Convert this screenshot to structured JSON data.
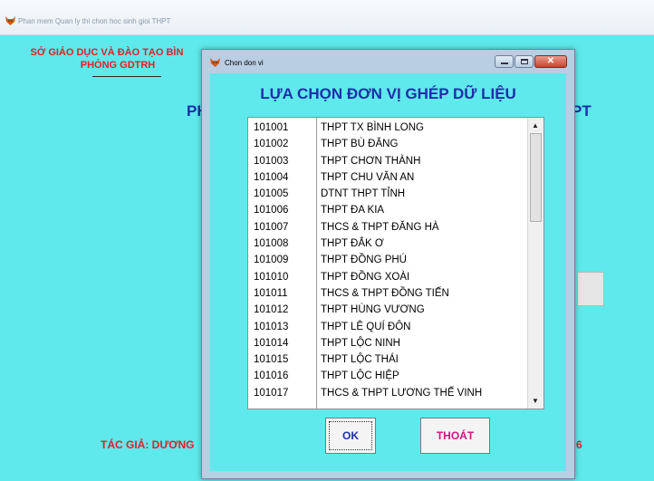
{
  "main_window": {
    "title": "Phan mem Quan ly thi chon hoc sinh gioi THPT",
    "dept_line1": "SỞ GIÁO DỤC VÀ ĐÀO TẠO BÌN",
    "dept_line2": "PHÒNG GDTRH",
    "title_left_fragment": "PH",
    "title_right_fragment": "PT",
    "author_left": "TÁC GIẢ: DƯƠNG",
    "author_right": "6"
  },
  "dialog": {
    "title": "Chon don vi",
    "heading": "LỰA CHỌN ĐƠN VỊ GHÉP DỮ LIỆU",
    "units": [
      {
        "code": "101001",
        "name": "THPT TX BÌNH LONG"
      },
      {
        "code": "101002",
        "name": "THPT BÙ ĐĂNG"
      },
      {
        "code": "101003",
        "name": "THPT CHƠN THÀNH"
      },
      {
        "code": "101004",
        "name": "THPT CHU VĂN AN"
      },
      {
        "code": "101005",
        "name": "DTNT THPT TỈNH"
      },
      {
        "code": "101006",
        "name": "THPT ĐA KIA"
      },
      {
        "code": "101007",
        "name": "THCS & THPT ĐĂNG HÀ"
      },
      {
        "code": "101008",
        "name": "THPT ĐẮK Ơ"
      },
      {
        "code": "101009",
        "name": "THPT ĐỒNG PHÚ"
      },
      {
        "code": "101010",
        "name": "THPT ĐỒNG XOÀI"
      },
      {
        "code": "101011",
        "name": "THCS & THPT ĐỒNG TIẾN"
      },
      {
        "code": "101012",
        "name": "THPT HÙNG VƯƠNG"
      },
      {
        "code": "101013",
        "name": "THPT LÊ QUÍ ĐÔN"
      },
      {
        "code": "101014",
        "name": "THPT LỘC NINH"
      },
      {
        "code": "101015",
        "name": "THPT LỘC THÁI"
      },
      {
        "code": "101016",
        "name": "THPT LỘC HIỆP"
      },
      {
        "code": "101017",
        "name": "THCS & THPT LƯƠNG THẾ VINH"
      }
    ],
    "ok_label": "OK",
    "exit_label": "THOÁT",
    "scroll_up_glyph": "▲",
    "scroll_down_glyph": "▼",
    "close_glyph": "✕"
  },
  "icons": {
    "app_icon": "fox-icon",
    "minimize": "minimize-icon",
    "maximize": "maximize-icon",
    "close": "close-icon"
  }
}
